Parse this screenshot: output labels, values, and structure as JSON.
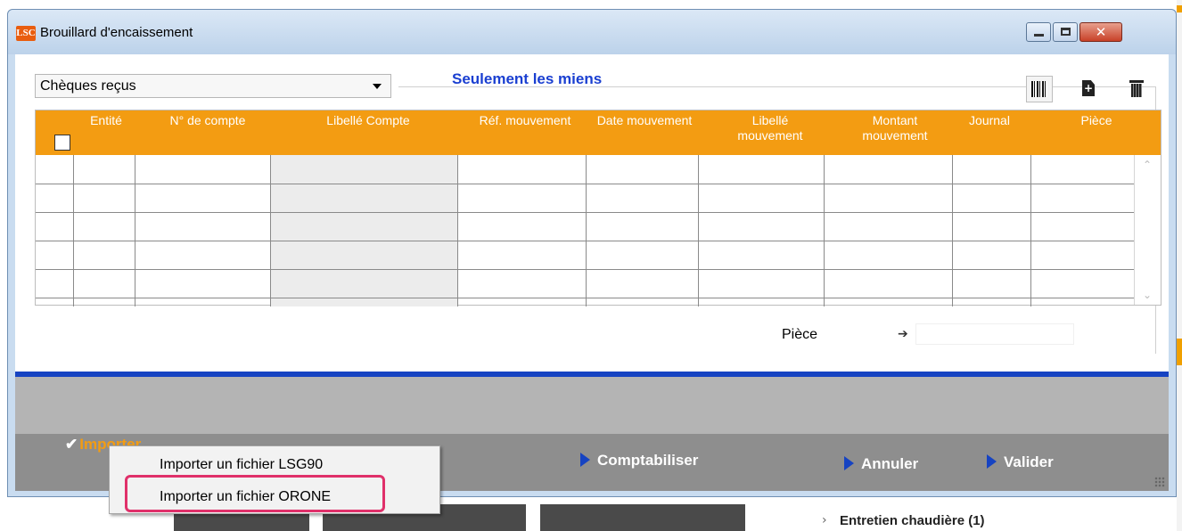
{
  "window": {
    "logo": "LSC",
    "title": "Brouillard d'encaissement",
    "close_glyph": "✕"
  },
  "filter": {
    "selected": "Chèques reçus",
    "only_mine_label": "Seulement les miens"
  },
  "toolbar": {
    "icons": [
      "barcode-icon",
      "new-document-icon",
      "trash-icon"
    ],
    "new_glyph": "+"
  },
  "table": {
    "columns": [
      "Entité",
      "N° de compte",
      "Libellé Compte",
      "Réf. mouvement",
      "Date mouvement",
      "Libellé mouvement",
      "Montant mouvement",
      "Journal",
      "Pièce"
    ],
    "rows": [
      [
        "",
        "",
        "",
        "",
        "",
        "",
        "",
        "",
        ""
      ],
      [
        "",
        "",
        "",
        "",
        "",
        "",
        "",
        "",
        ""
      ],
      [
        "",
        "",
        "",
        "",
        "",
        "",
        "",
        "",
        ""
      ],
      [
        "",
        "",
        "",
        "",
        "",
        "",
        "",
        "",
        ""
      ],
      [
        "",
        "",
        "",
        "",
        "",
        "",
        "",
        "",
        ""
      ]
    ],
    "scroll_up": "⌃",
    "scroll_down": "⌄"
  },
  "piece": {
    "label": "Pièce",
    "arrow": "➔",
    "value": ""
  },
  "footer": {
    "importer_check": "✔",
    "importer_label": "Importer",
    "comptabiliser": "Comptabiliser",
    "annuler": "Annuler",
    "valider": "Valider"
  },
  "import_menu": {
    "items": [
      "Importer un fichier LSG90",
      "Importer un fichier ORONE"
    ],
    "highlighted": "Importer un fichier ORONE"
  },
  "background": {
    "chevron": "›",
    "item_label": "Entretien chaudière (1)"
  },
  "colors": {
    "header_orange": "#f39c12",
    "accent_blue": "#1643c2",
    "highlight_pink": "#e0306a"
  }
}
